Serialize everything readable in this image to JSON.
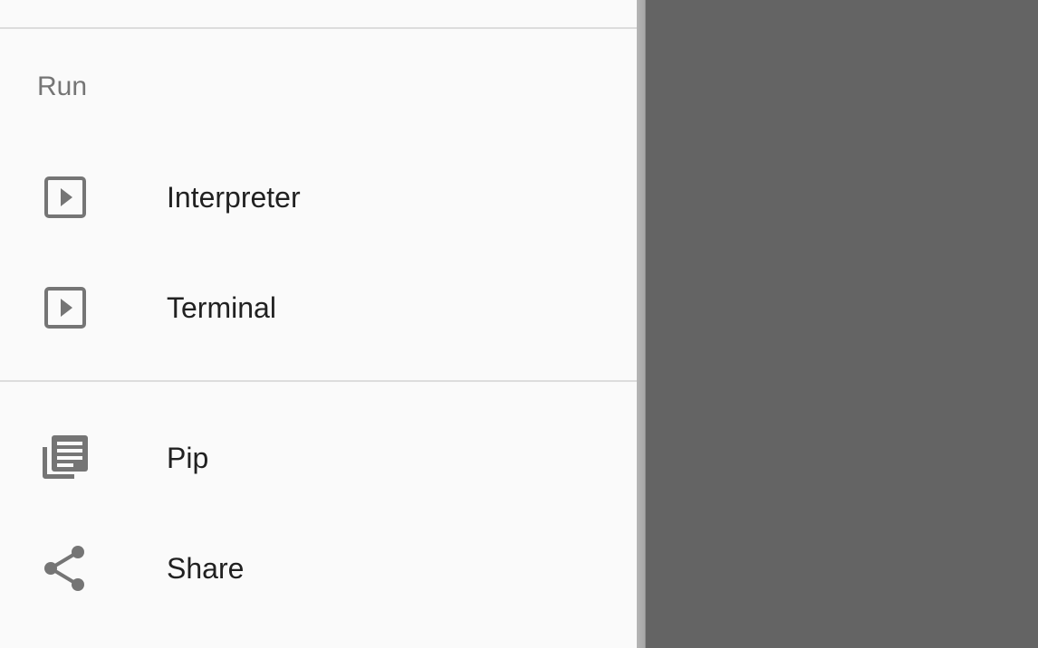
{
  "drawer": {
    "section_header": "Run",
    "run_items": [
      {
        "label": "Interpreter",
        "icon": "play-box-icon"
      },
      {
        "label": "Terminal",
        "icon": "play-box-icon"
      }
    ],
    "other_items": [
      {
        "label": "Pip",
        "icon": "library-books-icon"
      },
      {
        "label": "Share",
        "icon": "share-icon"
      }
    ]
  },
  "colors": {
    "drawer_background": "#fafafa",
    "scrim": "#646464",
    "icon": "#757575",
    "text_primary": "#212121",
    "text_secondary": "#757575",
    "divider": "#dcdcdc"
  }
}
